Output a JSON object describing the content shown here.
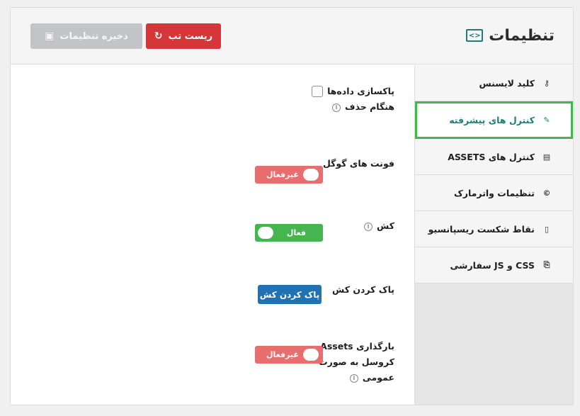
{
  "header": {
    "title": "تنظیمات",
    "reset_label": "ریست تب",
    "save_label": "ذخیره تنظیمات"
  },
  "sidebar": {
    "items": [
      {
        "label": "کلید لایسنس",
        "icon": "key-icon",
        "glyph": "⚷"
      },
      {
        "label": "کنترل های پیشرفته",
        "icon": "tools-icon",
        "glyph": "✎"
      },
      {
        "label": "کنترل های ASSETS",
        "icon": "assets-icon",
        "glyph": "▤"
      },
      {
        "label": "تنظیمات واترمارک",
        "icon": "copyright-icon",
        "glyph": "©"
      },
      {
        "label": "نقاط شکست ریسپانسیو",
        "icon": "mobile-icon",
        "glyph": "▯"
      },
      {
        "label": "CSS و JS سفارشی",
        "icon": "code-file-icon",
        "glyph": "⎘"
      }
    ],
    "active_index": 1
  },
  "settings": {
    "data_cleanup": {
      "label_line1": "پاکسازی داده‌ها",
      "label_line2": "هنگام حذف",
      "checked": false
    },
    "google_fonts": {
      "label": "فونت های گوگل",
      "state": "غیرفعال",
      "on": false
    },
    "cache": {
      "label": "کش",
      "state": "فعال",
      "on": true
    },
    "clear_cache": {
      "label": "پاک کردن کش",
      "button": "پاک کردن کش"
    },
    "carousel_assets": {
      "label_line1": "بارگذاری Assets",
      "label_line2": "کروسل به صورت",
      "label_line3": "عمومی",
      "state": "غیرفعال",
      "on": false
    }
  },
  "colors": {
    "accent": "#1d7d7d",
    "reset": "#d63638",
    "active_border": "#46b450",
    "toggle_on": "#46b450",
    "toggle_off": "#e86d6d",
    "primary_button": "#2271b1"
  }
}
